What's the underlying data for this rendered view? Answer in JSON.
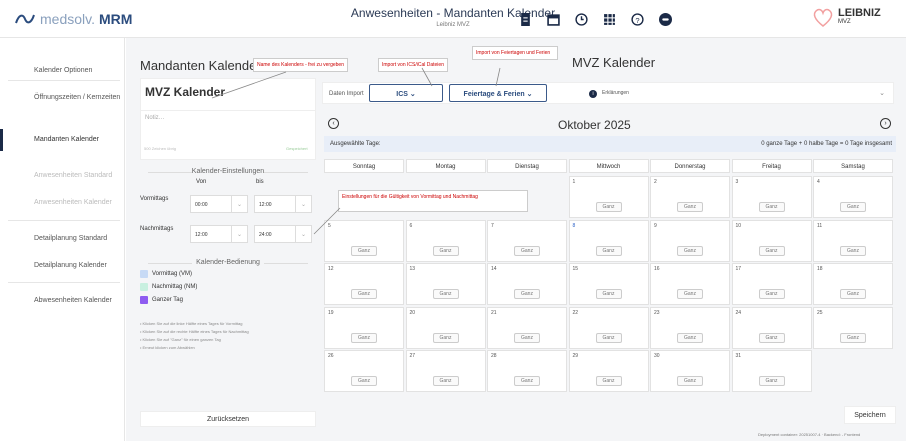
{
  "header": {
    "logo_pre": "medsolv.",
    "logo_bold": "MRM",
    "title": "Anwesenheiten - Mandanten Kalender",
    "subtitle": "Leibniz MVZ",
    "brand_main": "LEIBNIZ",
    "brand_sub": "MVZ",
    "icons": [
      "document-icon",
      "calendar-icon",
      "clock-icon",
      "grid-icon",
      "help-icon",
      "avatar-icon"
    ]
  },
  "sidebar": {
    "items": [
      {
        "label": "Kalender Optionen"
      },
      {
        "label": "Öffnungszeiten / Kernzeiten"
      },
      {
        "label": "Mandanten Kalender"
      },
      {
        "label": "Anwesenheiten Standard"
      },
      {
        "label": "Anwesenheiten Kalender"
      },
      {
        "label": "Detailplanung Standard"
      },
      {
        "label": "Detailplanung Kalender"
      },
      {
        "label": "Abwesenheiten Kalender"
      }
    ]
  },
  "left": {
    "heading": "Mandanten Kalender",
    "calendar_name": "MVZ Kalender",
    "notes_placeholder": "Notiz…",
    "notes_count": "500 Zeichen übrig",
    "notes_saved": "Gespeichert",
    "settings_title": "Kalender-Einstellungen",
    "from": "Von",
    "to": "bis",
    "morning": "Vormittags",
    "afternoon": "Nachmittags",
    "morning_from": "00:00",
    "morning_to": "12:00",
    "afternoon_from": "12:00",
    "afternoon_to": "24:00",
    "controls_title": "Kalender-Bedienung",
    "legend": [
      {
        "label": "Vormittag (VM)",
        "color": "#c7daf5"
      },
      {
        "label": "Nachmittag (NM)",
        "color": "#c8f0e0"
      },
      {
        "label": "Ganzer Tag",
        "color": "#8e5cf0"
      }
    ],
    "hints": [
      "• Klicken Sie auf die linke Hälfte eines Tages für Vormittag",
      "• Klicken Sie auf die rechte Hälfte eines Tages für Nachmittag",
      "• Klicken Sie auf \"Ganz\" für einen ganzen Tag",
      "• Erneut klicken zum Abwählen"
    ],
    "reset": "Zurücksetzen"
  },
  "right": {
    "heading": "MVZ Kalender",
    "import_label": "Daten Import",
    "ics": "ICS",
    "holidays": "Feiertage & Ferien",
    "explanations": "Erklärungen",
    "month": "Oktober 2025",
    "selected_label": "Ausgewählte Tage:",
    "selected_summary": "0 ganze Tage + 0 halbe Tage = 0 Tage insgesamt",
    "weekdays": [
      "Sonntag",
      "Montag",
      "Dienstag",
      "Mittwoch",
      "Donnerstag",
      "Freitag",
      "Samstag"
    ],
    "full_day": "Ganz",
    "save": "Speichern"
  },
  "calendar": {
    "weeks": [
      [
        null,
        null,
        null,
        1,
        2,
        3,
        4
      ],
      [
        5,
        6,
        7,
        8,
        9,
        10,
        11
      ],
      [
        12,
        13,
        14,
        15,
        16,
        17,
        18
      ],
      [
        19,
        20,
        21,
        22,
        23,
        24,
        25
      ],
      [
        26,
        27,
        28,
        29,
        30,
        31,
        null
      ]
    ],
    "highlight_day": 8
  },
  "annotations": {
    "name": "Name des Kalenders - frei zu vergeben",
    "ics": "Import von ICS/iCal Dateien",
    "holidays": "Import von Feiertagen und Ferien",
    "settings": "Einstellungen für die Gültigkeit von Vormittag und Nachmittag"
  },
  "footer": "Deployment container: 20251007-4 · Backend: -   Frontend"
}
